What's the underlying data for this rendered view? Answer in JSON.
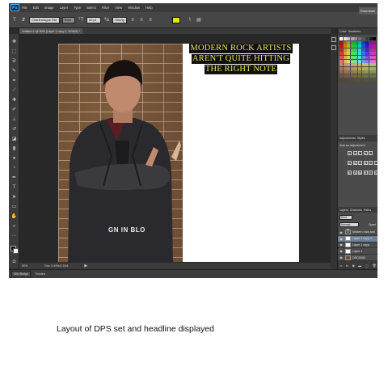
{
  "app": {
    "logo": "Ps"
  },
  "menu": [
    "File",
    "Edit",
    "Image",
    "Layer",
    "Type",
    "Select",
    "Filter",
    "View",
    "Window",
    "Help"
  ],
  "options_bar": {
    "font_family": "Charlemagne Std",
    "font_style": "Bold",
    "font_size": "60 pt",
    "antialias": "Strong",
    "text_color": "#e3e600",
    "workspace": "Essentials"
  },
  "document_tab": {
    "title": "Untitled-1 @ 50% (Layer 1 copy 2, RGB/8) *"
  },
  "canvas": {
    "headline": [
      "MODERN ROCK ARTISTS",
      "AREN'T QUITE HITTING",
      "THE RIGHT NOTE"
    ],
    "shirt_text": "GN IN BLO"
  },
  "status_bar": {
    "zoom": "50%",
    "doc_info": "Doc: 5.49M/8.34M"
  },
  "bottom_bar": {
    "tabs": [
      "Mini Bridge",
      "Timeline"
    ]
  },
  "right_panel": {
    "color_tabs": [
      "Color",
      "Swatches"
    ],
    "adjustment_tabs": [
      "Adjustments",
      "Styles"
    ],
    "add_adjustment": "Add an adjustment",
    "layer_tabs": [
      "Layers",
      "Channels",
      "Paths"
    ],
    "kind_filter": "Kind",
    "blend_mode": "Normal",
    "opacity_label": "Opaci",
    "layers": [
      {
        "name": "Modern rock and",
        "type": "text",
        "selected": false
      },
      {
        "name": "Layer 1 copy 2",
        "type": "image",
        "selected": true
      },
      {
        "name": "Layer 1 copy",
        "type": "image",
        "selected": false
      },
      {
        "name": "Layer 1",
        "type": "image",
        "selected": false
      },
      {
        "name": "DSC0002",
        "type": "photo",
        "selected": false
      }
    ]
  },
  "caption": "Layout of DPS set and headline displayed"
}
